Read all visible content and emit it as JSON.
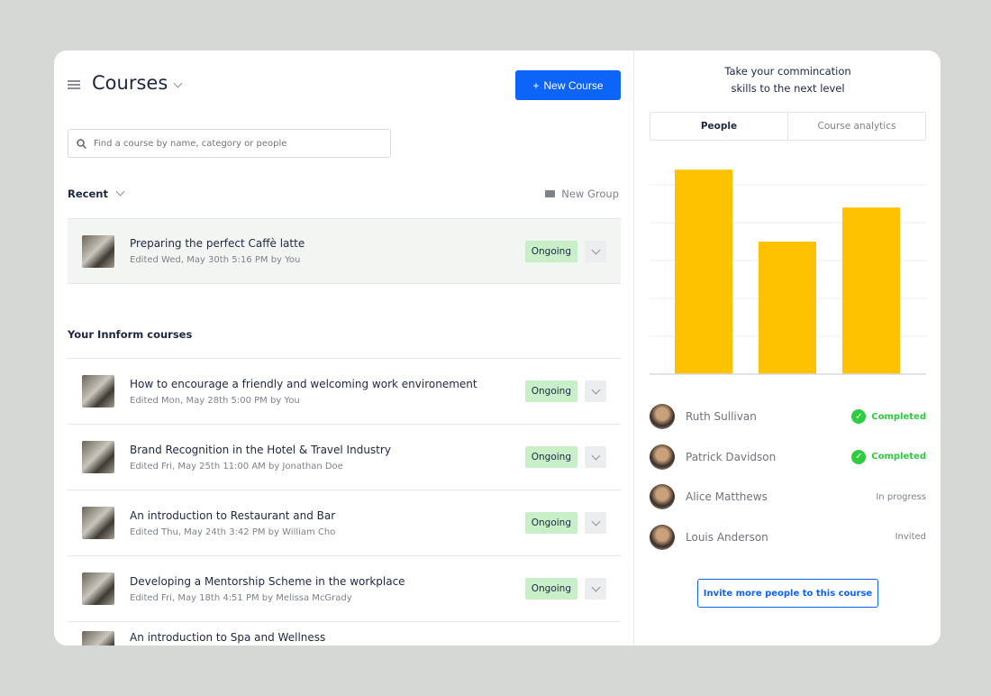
{
  "header": {
    "title": "Courses",
    "new_course": "New Course",
    "new_course_icon": "plus-icon"
  },
  "search": {
    "placeholder": "Find a course by name, category or people"
  },
  "recent": {
    "label": "Recent",
    "new_group": "New Group",
    "items": [
      {
        "title": "Preparing the perfect Caffè latte",
        "subtitle": "Edited Wed, May 30th 5:16 PM by You",
        "status": "Ongoing"
      }
    ]
  },
  "courses": {
    "label": "Your Innform courses",
    "items": [
      {
        "title": "How to encourage a friendly and welcoming work environement",
        "subtitle": "Edited Mon, May 28th 5:00 PM by You",
        "status": "Ongoing"
      },
      {
        "title": "Brand Recognition in the Hotel & Travel Industry",
        "subtitle": "Edited Fri, May 25th 11:00 AM by Jonathan Doe",
        "status": "Ongoing"
      },
      {
        "title": "An introduction to Restaurant and Bar",
        "subtitle": "Edited Thu, May 24th 3:42 PM by William Cho",
        "status": "Ongoing"
      },
      {
        "title": "Developing a Mentorship Scheme in the workplace",
        "subtitle": "Edited Fri, May 18th 4:51 PM by Melissa McGrady",
        "status": "Ongoing"
      },
      {
        "title": "An introduction to Spa and Wellness",
        "subtitle": "",
        "status": ""
      }
    ]
  },
  "panel": {
    "title_line1": "Take your commincation",
    "title_line2": "skills to the next level",
    "tabs": [
      "People",
      "Course analytics"
    ],
    "people": [
      {
        "name": "Ruth Sullivan",
        "status": "Completed",
        "done": true
      },
      {
        "name": "Patrick Davidson",
        "status": "Completed",
        "done": true
      },
      {
        "name": "Alice Matthews",
        "status": "In progress",
        "done": false
      },
      {
        "name": "Louis Anderson",
        "status": "Invited",
        "done": false
      }
    ],
    "invite": "Invite more people to this course"
  },
  "colors": {
    "accent": "#0d64f9",
    "bar": "#ffc200",
    "badge": "#c9efc9",
    "completed": "#2ecc40"
  },
  "chart_data": {
    "type": "bar",
    "categories": [
      "",
      "",
      ""
    ],
    "values": [
      5.4,
      3.5,
      4.4
    ],
    "ylim": [
      0,
      5.4
    ],
    "grid": true,
    "gridlines": [
      1,
      2,
      3,
      4,
      5
    ],
    "title": "",
    "xlabel": "",
    "ylabel": ""
  }
}
